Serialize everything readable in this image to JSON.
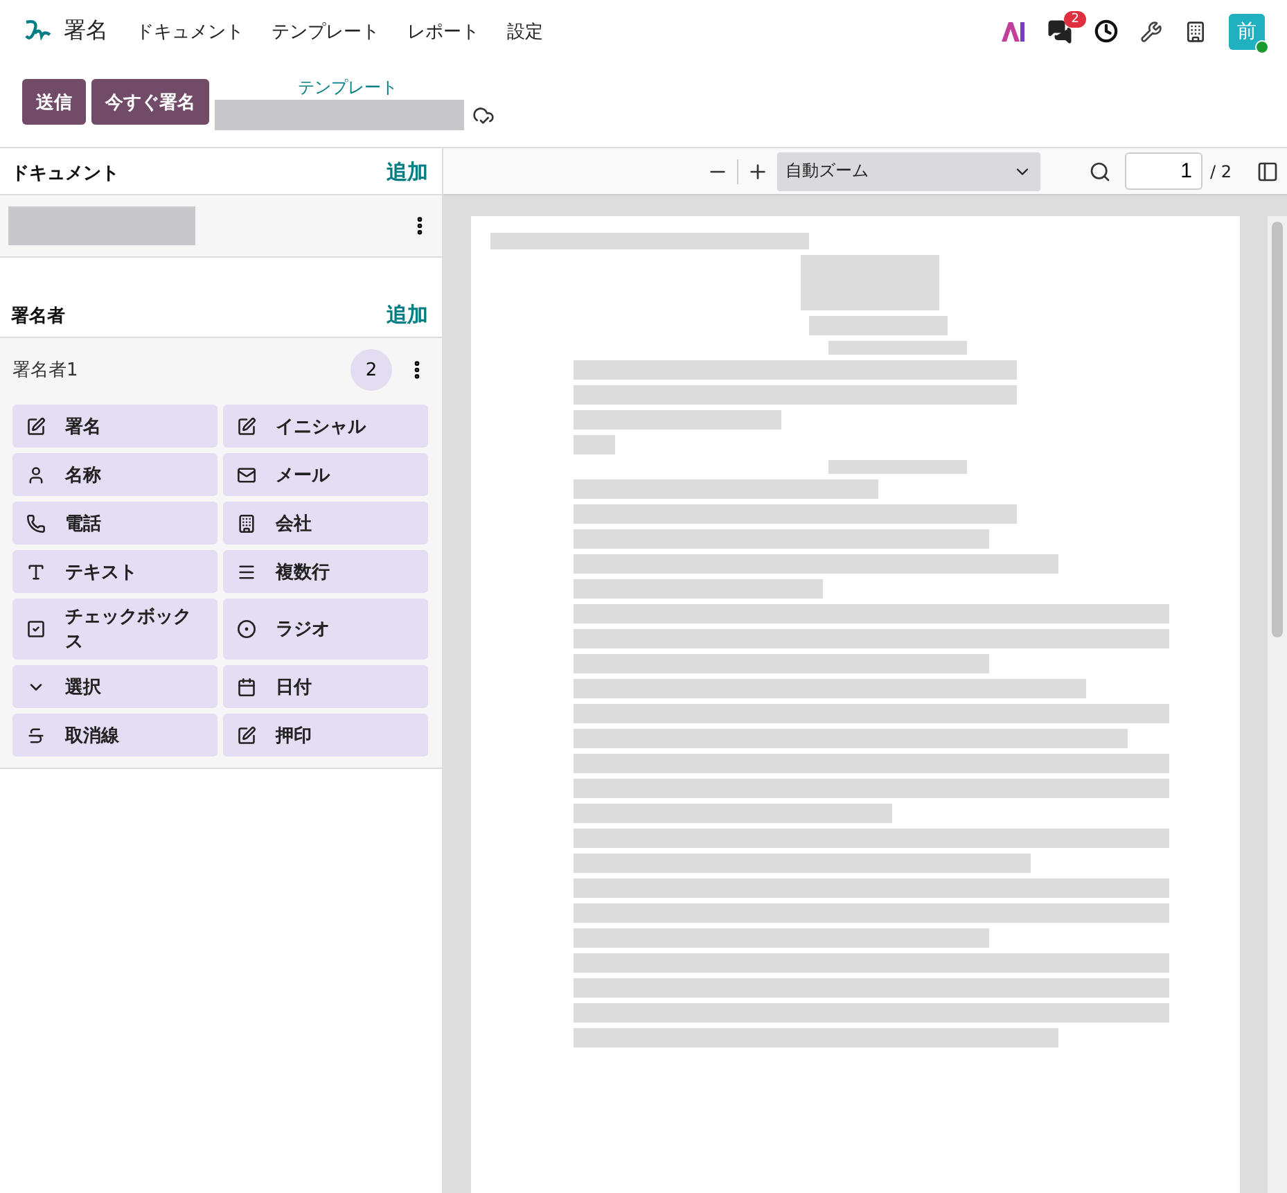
{
  "app": {
    "title": "署名",
    "menu": [
      "ドキュメント",
      "テンプレート",
      "レポート",
      "設定"
    ],
    "message_count": "2",
    "user_initial": "前",
    "user_online": true
  },
  "actions": {
    "buttons": [
      "送信",
      "今すぐ署名"
    ],
    "breadcrumb": "テンプレート"
  },
  "documents": {
    "title": "ドキュメント",
    "add": "追加"
  },
  "signers": {
    "title": "署名者",
    "add": "追加",
    "items": [
      {
        "name": "署名者1",
        "count": "2"
      }
    ]
  },
  "fields": [
    {
      "label": "署名",
      "kind": "signature"
    },
    {
      "label": "イニシャル",
      "kind": "initial"
    },
    {
      "label": "名称",
      "kind": "name"
    },
    {
      "label": "メール",
      "kind": "email"
    },
    {
      "label": "電話",
      "kind": "phone"
    },
    {
      "label": "会社",
      "kind": "company"
    },
    {
      "label": "テキスト",
      "kind": "text"
    },
    {
      "label": "複数行",
      "kind": "multiline"
    },
    {
      "label": "チェックボックス",
      "kind": "checkbox"
    },
    {
      "label": "ラジオ",
      "kind": "radio"
    },
    {
      "label": "選択",
      "kind": "selection"
    },
    {
      "label": "日付",
      "kind": "date"
    },
    {
      "label": "取消線",
      "kind": "strike"
    },
    {
      "label": "押印",
      "kind": "stamp"
    }
  ],
  "viewer": {
    "zoom": "自動ズーム",
    "page": "1",
    "page_total": "/ 2"
  }
}
